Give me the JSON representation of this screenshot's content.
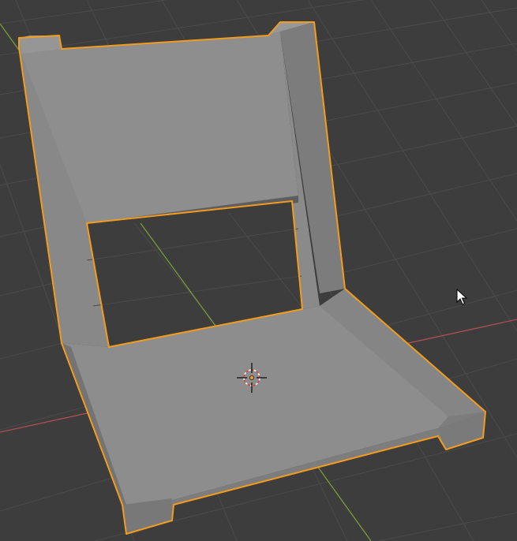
{
  "viewport": {
    "background": "#3d3d3d",
    "grid_color": "#4b4b4b",
    "x_axis_color": "#b04d55",
    "y_axis_color": "#7a9a3a",
    "selection_outline_color": "#f29c1f",
    "object_color_light": "#8e8e8e",
    "object_color_mid": "#7f7f7f",
    "object_color_dark": "#6f6f6f",
    "origin_icon": "origin-crosshair-icon",
    "cursor_icon": "arrow-cursor-icon"
  },
  "object": {
    "type": "mesh",
    "shape": "chair",
    "selected": true
  }
}
